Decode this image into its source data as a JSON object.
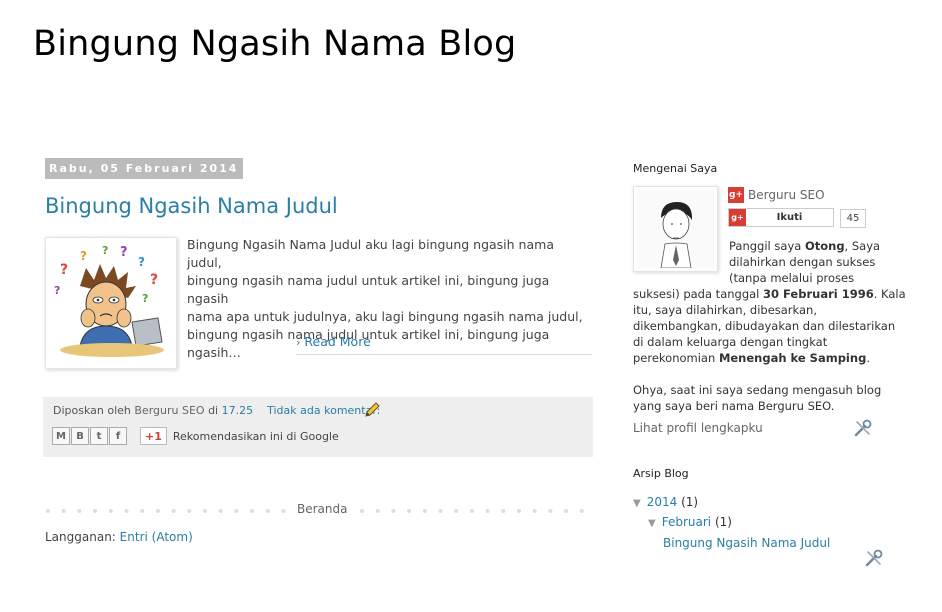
{
  "blog": {
    "title": "Bingung Ngasih Nama Blog"
  },
  "post": {
    "date": "Rabu, 05 Februari 2014",
    "title": "Bingung Ngasih Nama Judul",
    "snippet_lines": [
      "Bingung Ngasih Nama Judul aku lagi bingung ngasih nama judul,",
      "bingung ngasih nama judul untuk artikel ini, bingung juga ngasih",
      "nama apa untuk judulnya, aku lagi bingung ngasih nama judul,",
      "bingung ngasih nama judul untuk artikel ini, bingung juga ngasih…"
    ],
    "read_more": "Read More",
    "footer": {
      "posted_by": "Diposkan oleh",
      "author": "Berguru SEO",
      "at": "di",
      "time": "17.25",
      "comments": "Tidak ada komentar:",
      "share_buttons": [
        {
          "icon": "email-icon",
          "glyph": "M"
        },
        {
          "icon": "blogger-icon",
          "glyph": "B"
        },
        {
          "icon": "twitter-icon",
          "glyph": "t"
        },
        {
          "icon": "facebook-icon",
          "glyph": "f"
        }
      ],
      "plus_one": "+1",
      "recommend": "Rekomendasikan ini di Google"
    }
  },
  "pager": {
    "home": "Beranda"
  },
  "subscribe": {
    "label": "Langganan:",
    "link": "Entri (Atom)"
  },
  "sidebar": {
    "about": {
      "title": "Mengenai Saya",
      "name": "Berguru SEO",
      "follow": "Ikuti",
      "follow_count": "45",
      "bio": {
        "p1_a": "Panggil saya ",
        "p1_nick": "Otong",
        "p1_b": ", Saya",
        "line2": "dilahirkan dengan sukses",
        "line3": "(tanpa melalui proses",
        "line4_a": "suksesi) pada tanggal ",
        "line4_date": "30 Februari 1996",
        "line4_b": ". Kala",
        "line5": "itu, saya dilahirkan, dibesarkan,",
        "line6": "dikembangkan, dibudayakan dan dilestarikan",
        "line7": "di dalam keluarga dengan tingkat",
        "line8_a": "perekonomian ",
        "line8_b": "Menengah ke Samping",
        "line8_c": ".",
        "p2_line1": "Ohya, saat ini saya sedang mengasuh blog",
        "p2_line2": "yang saya beri nama Berguru SEO."
      },
      "profile_link": "Lihat profil lengkapku"
    },
    "archive": {
      "title": "Arsip Blog",
      "year": "2014",
      "year_count": "(1)",
      "month": "Februari",
      "month_count": "(1)",
      "post": "Bingung Ngasih Nama Judul",
      "toggle": "▼"
    }
  },
  "colors": {
    "link": "#2a7ea8",
    "date_bg": "#bbbbbb",
    "footer_bg": "#eeeeee",
    "gplus": "#d73d32"
  }
}
